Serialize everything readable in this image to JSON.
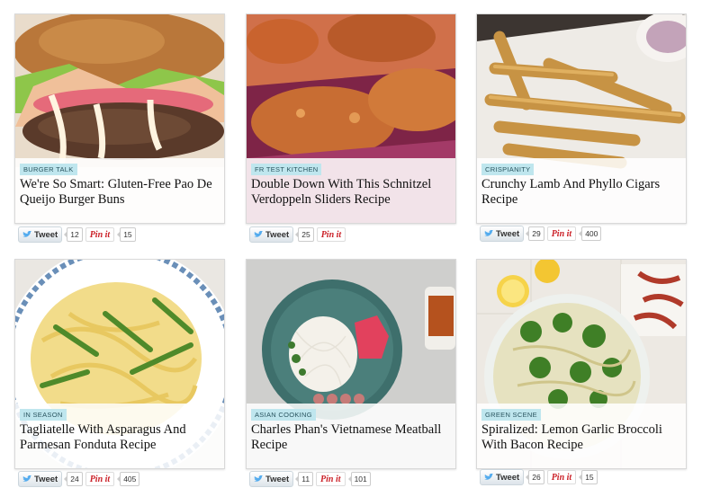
{
  "cards": [
    {
      "tag": "BURGER TALK",
      "title": "We're So Smart: Gluten-Free Pao De Queijo Burger Buns",
      "tweet_label": "Tweet",
      "tweet_count": "12",
      "pin_label": "Pin it",
      "pin_count": "15"
    },
    {
      "tag": "FR TEST KITCHEN",
      "title": "Double Down With This Schnitzel Verdoppeln Sliders Recipe",
      "tweet_label": "Tweet",
      "tweet_count": "25",
      "pin_label": "Pin it",
      "pin_count": ""
    },
    {
      "tag": "CRISPIANITY",
      "title": "Crunchy Lamb And Phyllo Cigars Recipe",
      "tweet_label": "Tweet",
      "tweet_count": "29",
      "pin_label": "Pin it",
      "pin_count": "400"
    },
    {
      "tag": "IN SEASON",
      "title": "Tagliatelle With Asparagus And Parmesan Fonduta Recipe",
      "tweet_label": "Tweet",
      "tweet_count": "24",
      "pin_label": "Pin it",
      "pin_count": "405"
    },
    {
      "tag": "ASIAN COOKING",
      "title": "Charles Phan's Vietnamese Meatball Recipe",
      "tweet_label": "Tweet",
      "tweet_count": "11",
      "pin_label": "Pin it",
      "pin_count": "101"
    },
    {
      "tag": "GREEN SCENE",
      "title": "Spiralized: Lemon Garlic Broccoli With Bacon Recipe",
      "tweet_label": "Tweet",
      "tweet_count": "26",
      "pin_label": "Pin it",
      "pin_count": "15"
    }
  ],
  "colors": {
    "tag_bg": "#bfe6ee",
    "pin_red": "#cb2027",
    "twitter_blue": "#55acee"
  }
}
